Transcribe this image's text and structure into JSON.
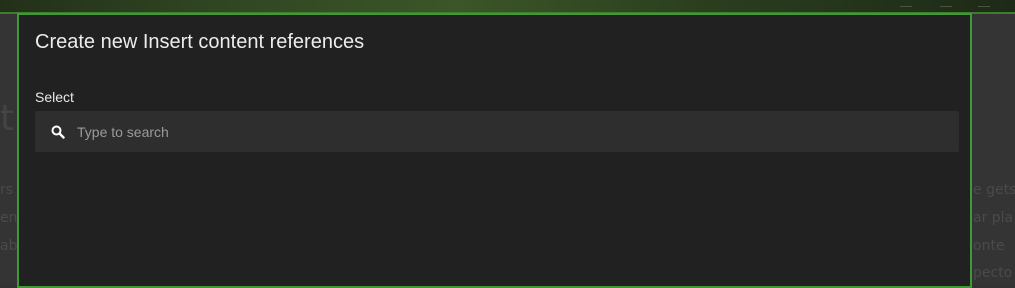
{
  "modal": {
    "title": "Create new Insert content references",
    "field_label": "Select",
    "search": {
      "value": "",
      "placeholder": "Type to search",
      "icon": "search-icon"
    }
  },
  "background_page": {
    "heading_fragment": "t",
    "left_fragments": [
      "rs",
      "en",
      "abi"
    ],
    "right_fragments": [
      "e gets",
      "ar pla",
      "onte",
      "pecto"
    ]
  },
  "colors": {
    "modal_background": "#212121",
    "modal_border": "#3f9a35",
    "search_background": "#2e2e2e",
    "title_text": "#ececec"
  }
}
